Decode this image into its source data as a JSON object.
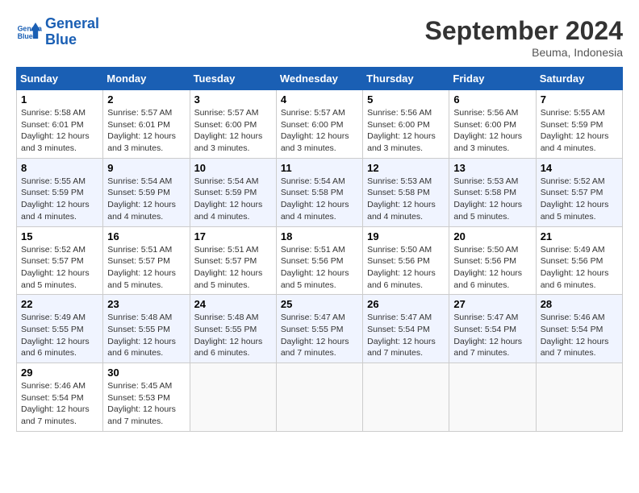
{
  "header": {
    "logo_line1": "General",
    "logo_line2": "Blue",
    "month_title": "September 2024",
    "subtitle": "Beuma, Indonesia"
  },
  "weekdays": [
    "Sunday",
    "Monday",
    "Tuesday",
    "Wednesday",
    "Thursday",
    "Friday",
    "Saturday"
  ],
  "weeks": [
    [
      {
        "day": "1",
        "info": "Sunrise: 5:58 AM\nSunset: 6:01 PM\nDaylight: 12 hours\nand 3 minutes."
      },
      {
        "day": "2",
        "info": "Sunrise: 5:57 AM\nSunset: 6:01 PM\nDaylight: 12 hours\nand 3 minutes."
      },
      {
        "day": "3",
        "info": "Sunrise: 5:57 AM\nSunset: 6:00 PM\nDaylight: 12 hours\nand 3 minutes."
      },
      {
        "day": "4",
        "info": "Sunrise: 5:57 AM\nSunset: 6:00 PM\nDaylight: 12 hours\nand 3 minutes."
      },
      {
        "day": "5",
        "info": "Sunrise: 5:56 AM\nSunset: 6:00 PM\nDaylight: 12 hours\nand 3 minutes."
      },
      {
        "day": "6",
        "info": "Sunrise: 5:56 AM\nSunset: 6:00 PM\nDaylight: 12 hours\nand 3 minutes."
      },
      {
        "day": "7",
        "info": "Sunrise: 5:55 AM\nSunset: 5:59 PM\nDaylight: 12 hours\nand 4 minutes."
      }
    ],
    [
      {
        "day": "8",
        "info": "Sunrise: 5:55 AM\nSunset: 5:59 PM\nDaylight: 12 hours\nand 4 minutes."
      },
      {
        "day": "9",
        "info": "Sunrise: 5:54 AM\nSunset: 5:59 PM\nDaylight: 12 hours\nand 4 minutes."
      },
      {
        "day": "10",
        "info": "Sunrise: 5:54 AM\nSunset: 5:59 PM\nDaylight: 12 hours\nand 4 minutes."
      },
      {
        "day": "11",
        "info": "Sunrise: 5:54 AM\nSunset: 5:58 PM\nDaylight: 12 hours\nand 4 minutes."
      },
      {
        "day": "12",
        "info": "Sunrise: 5:53 AM\nSunset: 5:58 PM\nDaylight: 12 hours\nand 4 minutes."
      },
      {
        "day": "13",
        "info": "Sunrise: 5:53 AM\nSunset: 5:58 PM\nDaylight: 12 hours\nand 5 minutes."
      },
      {
        "day": "14",
        "info": "Sunrise: 5:52 AM\nSunset: 5:57 PM\nDaylight: 12 hours\nand 5 minutes."
      }
    ],
    [
      {
        "day": "15",
        "info": "Sunrise: 5:52 AM\nSunset: 5:57 PM\nDaylight: 12 hours\nand 5 minutes."
      },
      {
        "day": "16",
        "info": "Sunrise: 5:51 AM\nSunset: 5:57 PM\nDaylight: 12 hours\nand 5 minutes."
      },
      {
        "day": "17",
        "info": "Sunrise: 5:51 AM\nSunset: 5:57 PM\nDaylight: 12 hours\nand 5 minutes."
      },
      {
        "day": "18",
        "info": "Sunrise: 5:51 AM\nSunset: 5:56 PM\nDaylight: 12 hours\nand 5 minutes."
      },
      {
        "day": "19",
        "info": "Sunrise: 5:50 AM\nSunset: 5:56 PM\nDaylight: 12 hours\nand 6 minutes."
      },
      {
        "day": "20",
        "info": "Sunrise: 5:50 AM\nSunset: 5:56 PM\nDaylight: 12 hours\nand 6 minutes."
      },
      {
        "day": "21",
        "info": "Sunrise: 5:49 AM\nSunset: 5:56 PM\nDaylight: 12 hours\nand 6 minutes."
      }
    ],
    [
      {
        "day": "22",
        "info": "Sunrise: 5:49 AM\nSunset: 5:55 PM\nDaylight: 12 hours\nand 6 minutes."
      },
      {
        "day": "23",
        "info": "Sunrise: 5:48 AM\nSunset: 5:55 PM\nDaylight: 12 hours\nand 6 minutes."
      },
      {
        "day": "24",
        "info": "Sunrise: 5:48 AM\nSunset: 5:55 PM\nDaylight: 12 hours\nand 6 minutes."
      },
      {
        "day": "25",
        "info": "Sunrise: 5:47 AM\nSunset: 5:55 PM\nDaylight: 12 hours\nand 7 minutes."
      },
      {
        "day": "26",
        "info": "Sunrise: 5:47 AM\nSunset: 5:54 PM\nDaylight: 12 hours\nand 7 minutes."
      },
      {
        "day": "27",
        "info": "Sunrise: 5:47 AM\nSunset: 5:54 PM\nDaylight: 12 hours\nand 7 minutes."
      },
      {
        "day": "28",
        "info": "Sunrise: 5:46 AM\nSunset: 5:54 PM\nDaylight: 12 hours\nand 7 minutes."
      }
    ],
    [
      {
        "day": "29",
        "info": "Sunrise: 5:46 AM\nSunset: 5:54 PM\nDaylight: 12 hours\nand 7 minutes."
      },
      {
        "day": "30",
        "info": "Sunrise: 5:45 AM\nSunset: 5:53 PM\nDaylight: 12 hours\nand 7 minutes."
      },
      null,
      null,
      null,
      null,
      null
    ]
  ]
}
